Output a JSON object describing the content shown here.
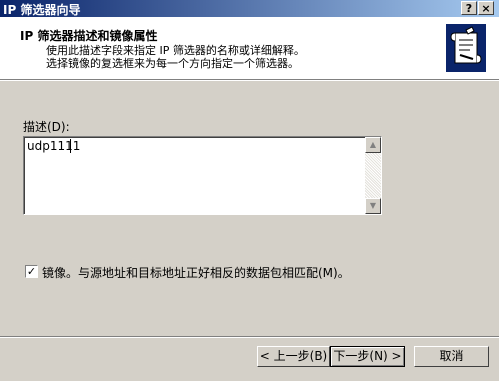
{
  "window": {
    "title": "IP 筛选器向导",
    "help_glyph": "?",
    "close_glyph": "×"
  },
  "header": {
    "heading": "IP 筛选器描述和镜像属性",
    "line1": "使用此描述字段来指定 IP 筛选器的名称或详细解释。",
    "line2": "选择镜像的复选框来为每一个方向指定一个筛选器。",
    "icon": "filter-scroll-icon"
  },
  "description": {
    "label": "描述(D):",
    "value": "udp1111"
  },
  "mirror": {
    "checked": true,
    "check_glyph": "✓",
    "label": "镜像。与源地址和目标地址正好相反的数据包相匹配(M)。"
  },
  "buttons": {
    "back": "< 上一步(B)",
    "next": "下一步(N) >",
    "cancel": "取消"
  },
  "scrollbar": {
    "up_glyph": "▲",
    "down_glyph": "▼"
  }
}
